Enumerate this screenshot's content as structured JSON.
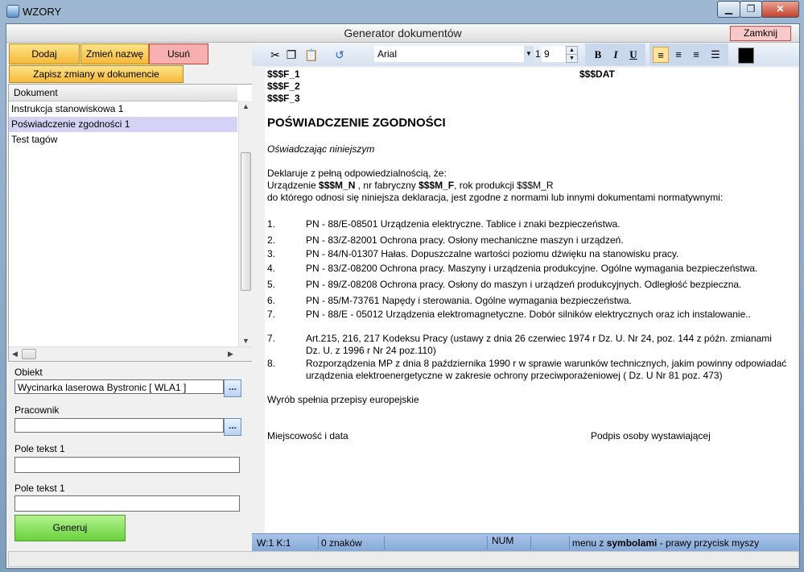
{
  "window": {
    "title": "WZORY",
    "minimize": "▁",
    "maximize": "❐",
    "close": "✕"
  },
  "header": {
    "title": "Generator dokumentów",
    "close_label": "Zamknij"
  },
  "left": {
    "add_label": "Dodaj",
    "rename_label": "Zmień nazwę",
    "delete_label": "Usuń",
    "save_label": "Zapisz zmiany w dokumencie",
    "list_header": "Dokument",
    "documents": [
      "Instrukcja stanowiskowa 1",
      "Poświadczenie zgodności 1",
      "Test tagów"
    ],
    "fields": {
      "obiekt_label": "Obiekt",
      "obiekt_value": "Wycinarka laserowa Bystronic [ WLA1 ]",
      "pracownik_label": "Pracownik",
      "pracownik_value": "",
      "pole1_label": "Pole tekst 1",
      "pole1_value": "",
      "pole2_label": "Pole tekst 1",
      "pole2_value": ""
    },
    "browse_label": "...",
    "generate_label": "Generuj"
  },
  "toolbar": {
    "font": "Arial",
    "size_prefix": "1",
    "size": "9",
    "bold": "B",
    "italic": "I",
    "underline": "U"
  },
  "document": {
    "tag1": "$$$F_1",
    "tag2": "$$$F_2",
    "tag3": "$$$F_3",
    "tag_date": "$$$DAT",
    "heading": "POŚWIADCZENIE  ZGODNOŚCI",
    "intro": "Oświadczając niniejszym",
    "decl1": "Deklaruje z pełną odpowiedzialnością, że:",
    "decl2_a": "Urządzenie ",
    "decl2_b": "$$$M_N",
    "decl2_c": " , nr fabryczny ",
    "decl2_d": "$$$M_F",
    "decl2_e": ",  rok produkcji $$$M_R",
    "decl3": "do którego odnosi się niniejsza deklaracja, jest zgodne z normami lub innymi dokumentami normatywnymi:",
    "items": [
      {
        "num": "1.",
        "text": "PN - 88/E-08501 Urządzenia elektryczne. Tablice i znaki bezpieczeństwa."
      },
      {
        "num": "2.",
        "text": "PN - 83/Z-82001  Ochrona pracy. Osłony mechaniczne maszyn i urządzeń."
      },
      {
        "num": "3.",
        "text": "PN - 84/N-01307 Hałas. Dopuszczalne wartości poziomu dźwięku  na stanowisku pracy."
      },
      {
        "num": "4.",
        "text": "PN - 83/Z-08200  Ochrona pracy. Maszyny i urządzenia produkcyjne. Ogólne wymagania  bezpieczeństwa."
      },
      {
        "num": "5.",
        "text": "PN - 89/Z-08208  Ochrona pracy. Osłony do maszyn i urządzeń  produkcyjnych. Odległość bezpieczna."
      },
      {
        "num": "6.",
        "text": "PN - 85/M-73761 Napędy i sterowania.  Ogólne wymagania bezpieczeństwa."
      },
      {
        "num": "7.",
        "text": "PN - 88/E - 05012              Urządzenia elektromagnetyczne. Dobór silników elektrycznych oraz ich  instalowanie.."
      }
    ],
    "item8": {
      "num": "7.",
      "line1": "Art.215, 216, 217 Kodeksu Pracy (ustawy z dnia 26 czerwiec 1974 r Dz. U. Nr 24, poz. 144 z późn. zmianami",
      "line2": "Dz. U. z 1996 r Nr 24 poz.110)"
    },
    "item9": {
      "num": "8.",
      "line1": "Rozporządzenia MP z dnia 8 października 1990 r w sprawie warunków technicznych, jakim powinny odpowiadać",
      "line2": "urządzenia elektroenergetyczne w zakresie ochrony przeciwporażeniowej  ( Dz. U Nr 81 poz. 473)"
    },
    "eu": "Wyrób spełnia przepisy europejskie",
    "place_date": "Miejscowość i data",
    "signature": "Podpis osoby wystawiającej"
  },
  "status": {
    "pos": "W:1  K:1",
    "chars": "0 znaków",
    "num": "NUM",
    "hint_a": "menu z ",
    "hint_b": "symbolami",
    "hint_c": " - prawy przycisk myszy"
  }
}
